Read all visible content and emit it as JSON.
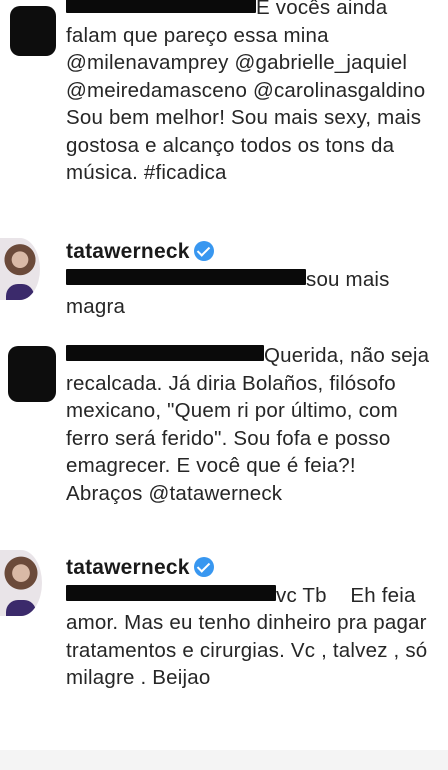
{
  "comments": [
    {
      "reply_text": "E vocês ainda falam que pareço essa mina @milenavamprey @gabrielle_jaquiel @meiredamasceno @carolinasgaldino Sou bem melhor! Sou mais sexy, mais gostosa e alcanço todos os tons da música. #ficadica"
    },
    {
      "username": "tatawerneck",
      "reply_text": "sou mais magra"
    },
    {
      "reply_text": "Querida, não seja recalcada. Já diria Bolaños, filósofo mexicano, \"Quem ri por último, com ferro será ferido\". Sou fofa e posso emagrecer. E você que é feia?! Abraços @tatawerneck"
    },
    {
      "username": "tatawerneck",
      "reply_text": "vc Tb    Eh feia amor. Mas eu tenho dinheiro pra pagar tratamentos e cirurgias. Vc , talvez , só milagre . Beijao"
    }
  ]
}
